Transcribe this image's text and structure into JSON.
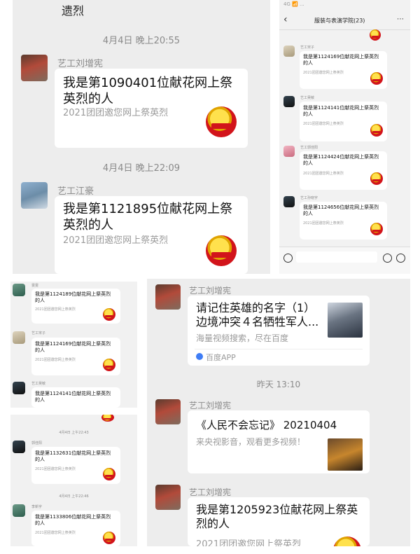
{
  "panel_a": {
    "top_snippet": "遗烈",
    "msg1": {
      "time": "4月4日 晚上20:55",
      "sender": "艺工刘增宪",
      "title": "我是第1090401位献花网上祭英烈的人",
      "subtitle": "2021团团邀您网上祭英烈"
    },
    "msg2": {
      "time": "4月4日 晚上22:09",
      "sender": "艺工江豪",
      "title": "我是第1121895位献花网上祭英烈的人",
      "subtitle": "2021团团邀您网上祭英烈"
    }
  },
  "panel_b": {
    "status_bar": "4G 📶 ...",
    "back": "‹",
    "group_title": "服装与表演学院(23)",
    "more": "⋯",
    "msgs": [
      {
        "sender": "艺工宋子",
        "title": "我是第1124169位献花网上祭英烈的人",
        "subtitle": "2021团团邀您网上祭英烈"
      },
      {
        "sender": "艺工吴敏",
        "title": "我是第1124141位献花网上祭英烈的人",
        "subtitle": "2021团团邀您网上祭英烈"
      },
      {
        "sender": "艺工郭佳阳",
        "title": "我是第1124424位献花网上祭英烈的人",
        "subtitle": "2021团团邀您网上祭英烈"
      },
      {
        "sender": "艺工孙晓宇",
        "title": "我是第1124656位献花网上祭英烈的人",
        "subtitle": "2021团团邀您网上祭英烈"
      }
    ]
  },
  "panel_c": {
    "msgs": [
      {
        "sender": "雯雯",
        "title": "我是第1124189位献花网上祭英烈的人",
        "subtitle": "2021团团邀您网上祭英烈"
      },
      {
        "sender": "艺工宋子",
        "title": "我是第1124169位献花网上祭英烈的人",
        "subtitle": "2021团团邀您网上祭英烈"
      },
      {
        "sender": "艺工吴敏",
        "title": "我是第1124141位献花网上祭英烈的人",
        "subtitle": "2021团团邀您网上祭英烈"
      }
    ]
  },
  "panel_d": {
    "time1": "4月4日 上午22:43",
    "msg1": {
      "sender": "郭佳阳",
      "title": "我是第1132631位献花网上祭英烈的人",
      "subtitle": "2021团团邀您网上祭英烈"
    },
    "time2": "4月4日 上午22:46",
    "msg2": {
      "sender": "李新宇",
      "title": "我是第1133806位献花网上祭英烈的人",
      "subtitle": "2021团团邀您网上祭英烈"
    }
  },
  "panel_e": {
    "msg1": {
      "sender": "艺工刘增宪",
      "title": "请记住英雄的名字（1）边境冲突４名牺牲军人...",
      "subtitle": "海量视频搜索，尽在百度",
      "app": "百度APP"
    },
    "time": "昨天 13:10",
    "msg2": {
      "sender": "艺工刘增宪",
      "title": "《人民不会忘记》 20210404",
      "subtitle": "来央视影音，观看更多视频！"
    },
    "msg3": {
      "sender": "艺工刘增宪",
      "title": "我是第1205923位献花网上祭英烈的人",
      "subtitle": "2021团团邀您网上祭英烈"
    }
  }
}
